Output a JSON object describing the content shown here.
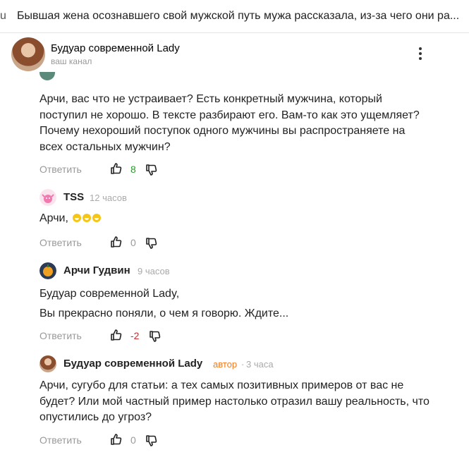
{
  "title_bar": {
    "prefix": "u",
    "text": "Бывшая жена осознавшего свой мужской путь мужа рассказала, из-за чего они ра..."
  },
  "channel": {
    "name": "Будуар современной Lady",
    "subtitle": "ваш канал"
  },
  "icons": {
    "more": "more-vertical-icon",
    "like": "thumbs-up-icon",
    "dislike": "thumbs-down-icon"
  },
  "colors": {
    "positive": "#2a9a2a",
    "negative": "#d02a2a",
    "author_badge": "#f07a20"
  },
  "reply_label": "Ответить",
  "comments": [
    {
      "text_lines": [
        "Арчи, вас что не устраивает? Есть конкретный мужчина, который",
        "поступил не хорошо. В тексте разбирают его. Вам-то как это ущемляет?",
        "Почему нехороший поступок одного мужчины вы распространяете на",
        "всех остальных мужчин?"
      ],
      "likes": "8"
    },
    {
      "author": "TSS",
      "time": "12 часов",
      "text": "Арчи,",
      "likes": "0"
    },
    {
      "author": "Арчи Гудвин",
      "time": "9 часов",
      "text_lines": [
        "Будуар современной Lady,",
        "Вы прекрасно поняли, о чем я говорю. Ждите..."
      ],
      "likes": "-2"
    },
    {
      "author": "Будуар современной Lady",
      "badge": "автор",
      "separator": "·",
      "time": "3 часа",
      "text_lines": [
        "Арчи, сугубо для статьи: а тех самых позитивных примеров от вас не",
        "будет? Или мой частный пример настолько отразил вашу реальность, что",
        "опустились до угроз?"
      ],
      "likes": "0"
    }
  ]
}
